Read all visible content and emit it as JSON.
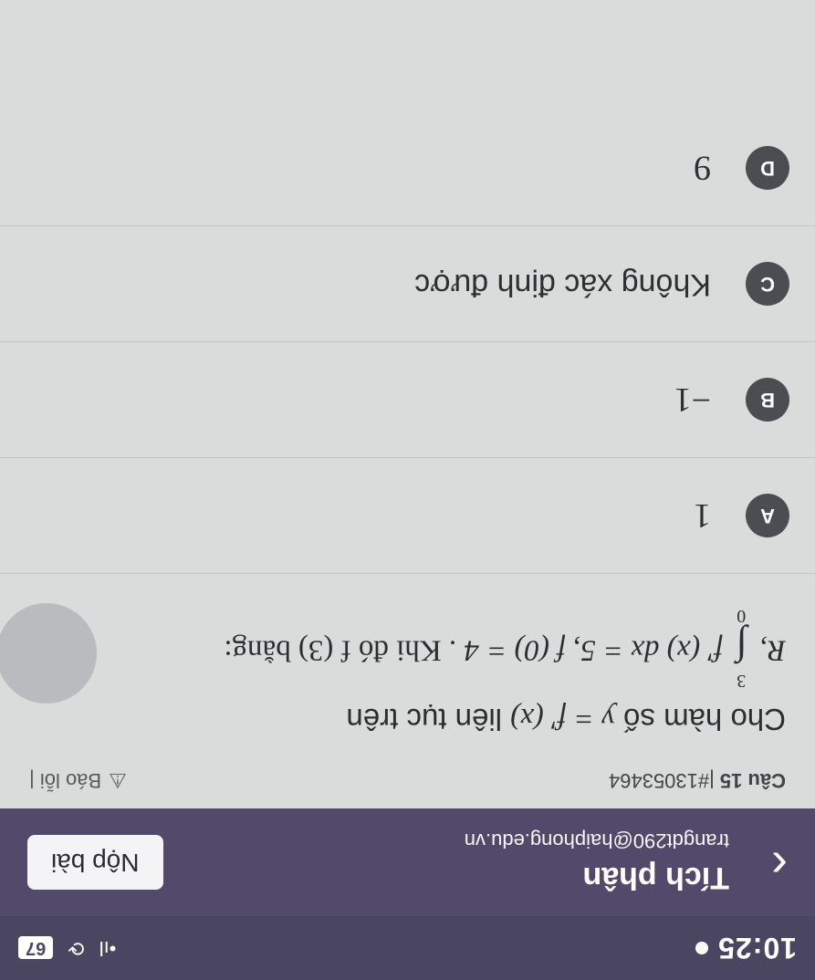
{
  "status_bar": {
    "time": "10:25",
    "signal": "•ıl",
    "battery": "67"
  },
  "header": {
    "title": "Tích phân",
    "email": "trangdt290@haiphong.edu.vn",
    "submit_label": "Nộp bài"
  },
  "question": {
    "number_label": "Câu 15",
    "id": "|#13053464",
    "report_label": "Báo lỗi |",
    "text_line1_a": "Cho hàm số ",
    "text_line1_math": "y = f′ (x)",
    "text_line1_b": " liên tục trên",
    "domain": "R",
    "integral_upper": "3",
    "integral_lower": "0",
    "integral_body": "f′ (x) dx = 5",
    "condition": "f (0) = 4",
    "ending": ". Khi đó f (3) bằng:"
  },
  "options": [
    {
      "letter": "A",
      "value": "1"
    },
    {
      "letter": "B",
      "value": "−1"
    },
    {
      "letter": "C",
      "value": "Không xác định được"
    },
    {
      "letter": "D",
      "value": "9"
    }
  ]
}
